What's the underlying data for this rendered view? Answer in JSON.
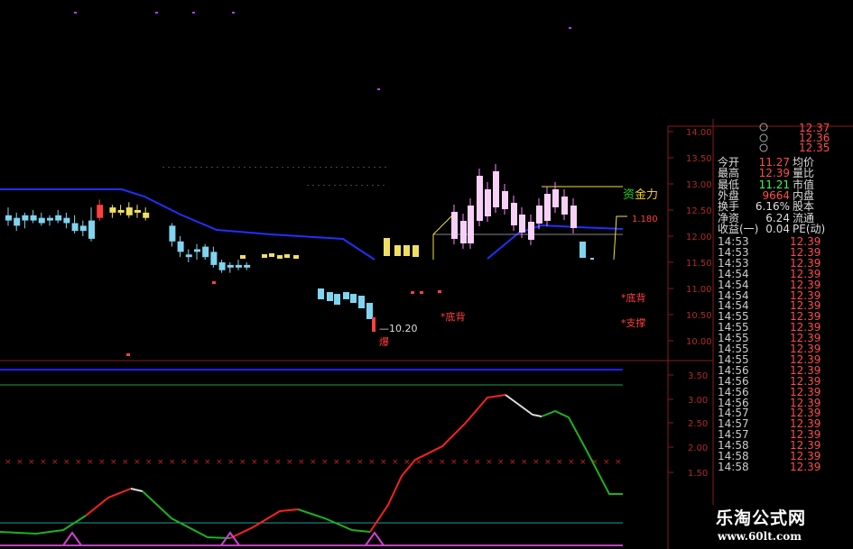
{
  "quote_panel": {
    "top_prices": [
      "12.37",
      "12.36",
      "12.35"
    ],
    "rows": [
      {
        "label": "今开",
        "value": "11.27",
        "label2": "均价",
        "color": "#ff4d4d"
      },
      {
        "label": "最高",
        "value": "12.39",
        "label2": "量比",
        "color": "#ff4d4d"
      },
      {
        "label": "最低",
        "value": "11.21",
        "label2": "市值",
        "color": "#3dff3d"
      },
      {
        "label": "外盘",
        "value": "9664",
        "label2": "内盘",
        "color": "#ff4d4d"
      },
      {
        "label": "换手",
        "value": "6.16%",
        "label2": "股本",
        "color": "#dddddd"
      },
      {
        "label": "净资",
        "value": "6.24",
        "label2": "流通",
        "color": "#dddddd"
      },
      {
        "label": "收益(一)",
        "value": "0.04",
        "label2": "PE(动)",
        "color": "#dddddd"
      }
    ],
    "ticks": [
      {
        "time": "14:53",
        "price": "12.39"
      },
      {
        "time": "14:53",
        "price": "12.39"
      },
      {
        "time": "14:53",
        "price": "12.39"
      },
      {
        "time": "14:54",
        "price": "12.39"
      },
      {
        "time": "14:54",
        "price": "12.39"
      },
      {
        "time": "14:54",
        "price": "12.39"
      },
      {
        "time": "14:54",
        "price": "12.39"
      },
      {
        "time": "14:55",
        "price": "12.39"
      },
      {
        "time": "14:55",
        "price": "12.39"
      },
      {
        "time": "14:55",
        "price": "12.39"
      },
      {
        "time": "14:55",
        "price": "12.39"
      },
      {
        "time": "14:55",
        "price": "12.39"
      },
      {
        "time": "14:56",
        "price": "12.39"
      },
      {
        "time": "14:56",
        "price": "12.39"
      },
      {
        "time": "14:56",
        "price": "12.39"
      },
      {
        "time": "14:56",
        "price": "12.39"
      },
      {
        "time": "14:57",
        "price": "12.39"
      },
      {
        "time": "14:57",
        "price": "12.39"
      },
      {
        "time": "14:57",
        "price": "12.39"
      },
      {
        "time": "14:58",
        "price": "12.39"
      },
      {
        "time": "14:58",
        "price": "12.39"
      },
      {
        "time": "14:58",
        "price": "12.39"
      }
    ]
  },
  "price_axis": [
    "14.00",
    "13.50",
    "13.00",
    "12.50",
    "12.00",
    "11.50",
    "11.00",
    "10.50",
    "10.00"
  ],
  "indicator_axis": [
    "3.50",
    "3.00",
    "2.50",
    "2.00",
    "1.50"
  ],
  "annotations": {
    "low_price": "10.20",
    "explode": "爆",
    "divergence_1": "底背",
    "divergence_2": "底背",
    "support": "支撑",
    "gold_power": "金力",
    "gold_char": "资",
    "level_label": "1.180"
  },
  "watermark": {
    "line1": "乐淘公式网",
    "line2": "www.60lt.com"
  },
  "colors": {
    "up": "#ff4040",
    "down": "#40c0ff",
    "line": "#2030ff",
    "k_line": "#ff2020",
    "d_line": "#20b020"
  },
  "chart_data": {
    "type": "candlestick",
    "ylim": [
      9.8,
      14.1
    ],
    "candles": [
      {
        "o": 12.4,
        "h": 12.55,
        "l": 12.2,
        "c": 12.3,
        "col": "down"
      },
      {
        "o": 12.35,
        "h": 12.45,
        "l": 12.1,
        "c": 12.2,
        "col": "down"
      },
      {
        "o": 12.3,
        "h": 12.45,
        "l": 12.15,
        "c": 12.4,
        "col": "down"
      },
      {
        "o": 12.4,
        "h": 12.5,
        "l": 12.25,
        "c": 12.3,
        "col": "down"
      },
      {
        "o": 12.35,
        "h": 12.45,
        "l": 12.2,
        "c": 12.25,
        "col": "down"
      },
      {
        "o": 12.3,
        "h": 12.4,
        "l": 12.2,
        "c": 12.35,
        "col": "down"
      },
      {
        "o": 12.4,
        "h": 12.5,
        "l": 12.25,
        "c": 12.3,
        "col": "down"
      },
      {
        "o": 12.35,
        "h": 12.45,
        "l": 12.15,
        "c": 12.25,
        "col": "down"
      },
      {
        "o": 12.25,
        "h": 12.4,
        "l": 12.05,
        "c": 12.1,
        "col": "down"
      },
      {
        "o": 12.1,
        "h": 12.3,
        "l": 12.0,
        "c": 12.2,
        "col": "down"
      },
      {
        "o": 12.3,
        "h": 12.55,
        "l": 11.9,
        "c": 11.95,
        "col": "down"
      },
      {
        "o": 12.35,
        "h": 12.7,
        "l": 12.3,
        "c": 12.6,
        "col": "up"
      },
      {
        "o": 12.45,
        "h": 12.6,
        "l": 12.35,
        "c": 12.55,
        "col": "yel"
      },
      {
        "o": 12.5,
        "h": 12.6,
        "l": 12.4,
        "c": 12.45,
        "col": "yel"
      },
      {
        "o": 12.4,
        "h": 12.65,
        "l": 12.35,
        "c": 12.55,
        "col": "yel"
      },
      {
        "o": 12.5,
        "h": 12.6,
        "l": 12.35,
        "c": 12.45,
        "col": "yel"
      },
      {
        "o": 12.45,
        "h": 12.55,
        "l": 12.3,
        "c": 12.35,
        "col": "yel"
      },
      {
        "o": 12.2,
        "h": 12.25,
        "l": 11.8,
        "c": 11.9,
        "col": "down"
      },
      {
        "o": 11.9,
        "h": 12.0,
        "l": 11.6,
        "c": 11.7,
        "col": "down"
      },
      {
        "o": 11.65,
        "h": 11.75,
        "l": 11.5,
        "c": 11.6,
        "col": "down"
      },
      {
        "o": 11.7,
        "h": 11.85,
        "l": 11.55,
        "c": 11.75,
        "col": "down"
      },
      {
        "o": 11.8,
        "h": 11.85,
        "l": 11.55,
        "c": 11.6,
        "col": "down"
      },
      {
        "o": 11.7,
        "h": 11.8,
        "l": 11.4,
        "c": 11.45,
        "col": "down"
      },
      {
        "o": 11.5,
        "h": 11.55,
        "l": 11.3,
        "c": 11.35,
        "col": "down"
      },
      {
        "o": 11.4,
        "h": 11.5,
        "l": 11.3,
        "c": 11.45,
        "col": "down"
      },
      {
        "o": 11.45,
        "h": 11.55,
        "l": 11.35,
        "c": 11.4,
        "col": "down"
      },
      {
        "o": 11.45,
        "h": 11.5,
        "l": 11.35,
        "c": 11.4,
        "col": "down"
      }
    ]
  }
}
